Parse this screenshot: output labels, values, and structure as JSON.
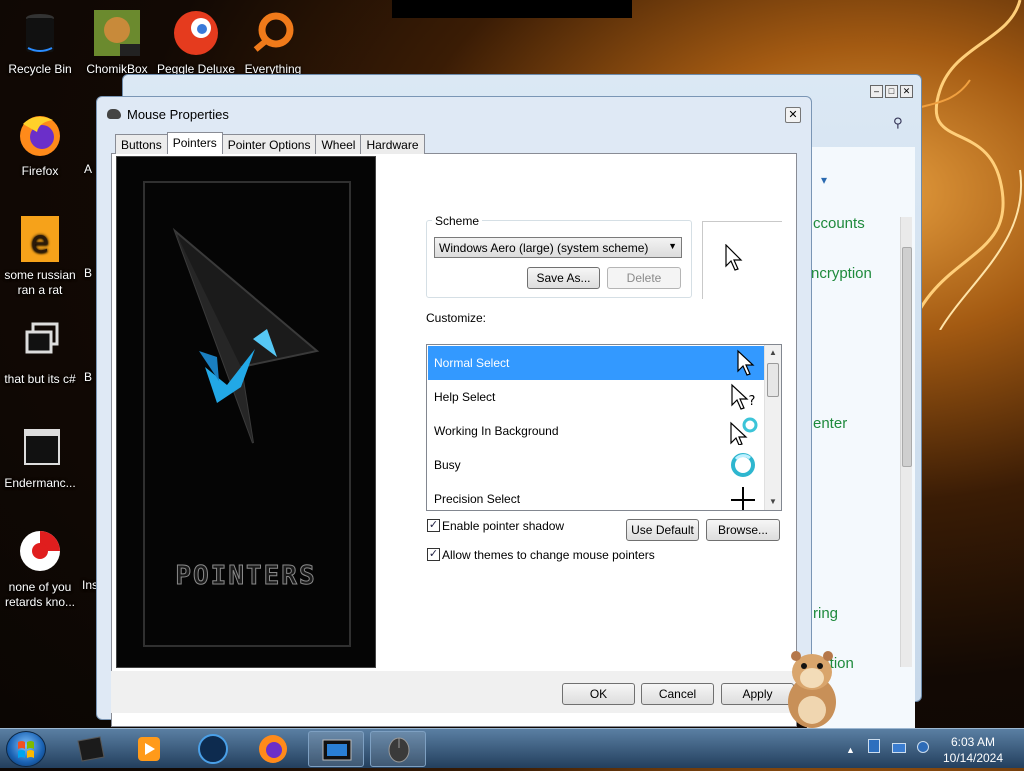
{
  "desktop": {
    "icons": [
      {
        "label": "Recycle Bin"
      },
      {
        "label": "ChomikBox"
      },
      {
        "label": "Peggle Deluxe"
      },
      {
        "label": "Everything"
      },
      {
        "label": "Firefox"
      },
      {
        "label": "some russian ran a rat"
      },
      {
        "label": "that but its c#"
      },
      {
        "label": "Endermanc..."
      },
      {
        "label": "none of you retards kno..."
      }
    ],
    "partial_labels": [
      "A",
      "B",
      "B",
      "Ins"
    ]
  },
  "background_window": {
    "links": [
      "ccounts",
      "ncryption",
      "enter",
      "ring",
      "nation"
    ],
    "caret": "▾"
  },
  "dialog": {
    "title": "Mouse Properties",
    "close": "✕",
    "tabs": [
      "Buttons",
      "Pointers",
      "Pointer Options",
      "Wheel",
      "Hardware"
    ],
    "active_tab": "Pointers",
    "preview_title": "POINTERS",
    "scheme": {
      "label": "Scheme",
      "selected": "Windows Aero (large) (system scheme)",
      "save_as": "Save As...",
      "delete": "Delete"
    },
    "customize_label": "Customize:",
    "cursors": [
      {
        "name": "Normal Select",
        "icon": "arrow-cursor-icon",
        "selected": true
      },
      {
        "name": "Help Select",
        "icon": "help-cursor-icon",
        "selected": false
      },
      {
        "name": "Working In Background",
        "icon": "working-cursor-icon",
        "selected": false
      },
      {
        "name": "Busy",
        "icon": "busy-cursor-icon",
        "selected": false
      },
      {
        "name": "Precision Select",
        "icon": "crosshair-cursor-icon",
        "selected": false
      }
    ],
    "enable_shadow": {
      "label": "Enable pointer shadow",
      "checked": true
    },
    "allow_themes": {
      "label": "Allow themes to change mouse pointers",
      "checked": true
    },
    "use_default": "Use Default",
    "browse": "Browse...",
    "ok": "OK",
    "cancel": "Cancel",
    "apply": "Apply"
  },
  "taskbar": {
    "clock_time": "6:03 AM",
    "clock_date": "10/14/2024",
    "tray_arrow": "▲"
  },
  "colors": {
    "selection": "#3399ff",
    "link_green": "#1e8a3c",
    "taskbar": "#3c5f83"
  }
}
